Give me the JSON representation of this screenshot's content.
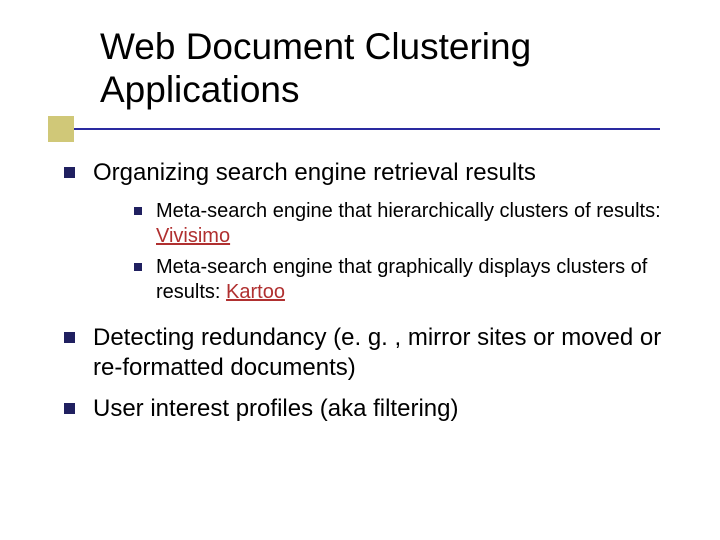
{
  "title": {
    "line1": "Web Document Clustering",
    "line2": "Applications"
  },
  "colors": {
    "rule": "#2a2aa0",
    "accent_box": "#d0c878",
    "bullet": "#202060",
    "link": "#b03030"
  },
  "bullets": [
    {
      "text": "Organizing search engine retrieval results",
      "sub": [
        {
          "pre": "Meta-search engine that hierarchically clusters of results: ",
          "link": "Vivisimo"
        },
        {
          "pre": "Meta-search engine that graphically displays clusters of results: ",
          "link": "Kartoo"
        }
      ]
    },
    {
      "text": "Detecting redundancy (e. g. , mirror sites or moved or re-formatted documents)"
    },
    {
      "text": "User interest profiles (aka filtering)"
    }
  ]
}
